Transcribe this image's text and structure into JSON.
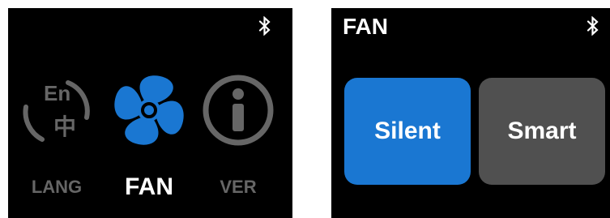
{
  "colors": {
    "screen_bg": "#000000",
    "accent": "#1a77d2",
    "inactive": "#666666",
    "inactive_button": "#505050",
    "text": "#ffffff"
  },
  "menu": {
    "items": [
      {
        "label": "LANG",
        "icon": "language-icon",
        "selected": false
      },
      {
        "label": "FAN",
        "icon": "fan-icon",
        "selected": true
      },
      {
        "label": "VER",
        "icon": "info-icon",
        "selected": false
      }
    ],
    "lang_icon_text": {
      "top": "En",
      "bottom": "中"
    },
    "status_icon": "bluetooth-icon"
  },
  "fan_screen": {
    "title": "FAN",
    "status_icon": "bluetooth-icon",
    "modes": [
      {
        "label": "Silent",
        "selected": true
      },
      {
        "label": "Smart",
        "selected": false
      }
    ]
  }
}
